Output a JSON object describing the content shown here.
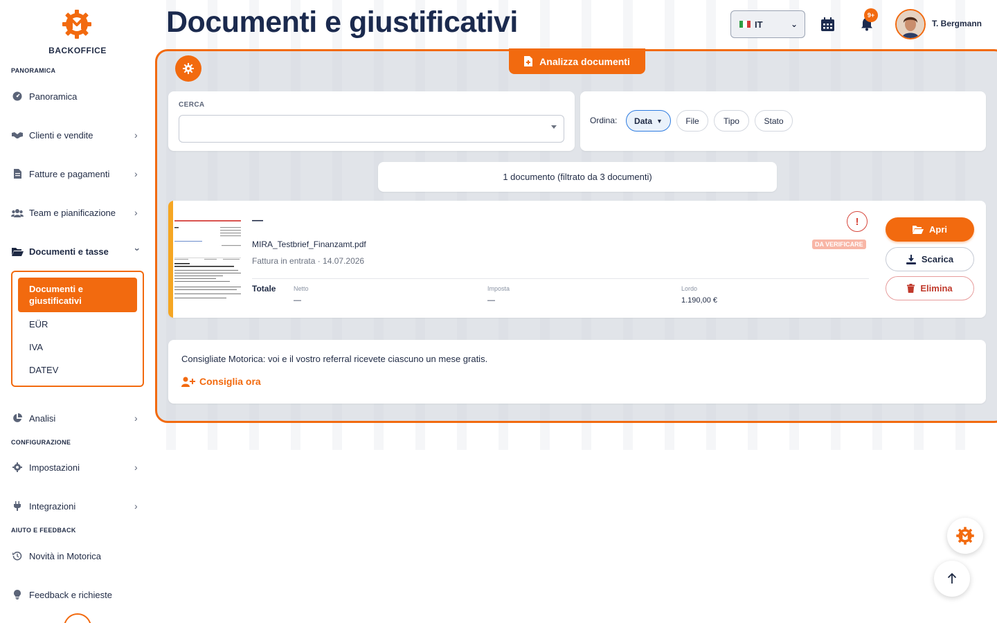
{
  "brand": {
    "name": "BACKOFFICE",
    "accent": "#f26a0f"
  },
  "header": {
    "title": "Documenti e giustificativi",
    "language": "IT",
    "notifications_badge": "9+",
    "user_name": "T. Bergmann"
  },
  "sidebar": {
    "section_overview": "PANORAMICA",
    "items": [
      {
        "label": "Panoramica",
        "icon": "dashboard-icon"
      },
      {
        "label": "Clienti e vendite",
        "icon": "handshake-icon"
      },
      {
        "label": "Fatture e pagamenti",
        "icon": "invoice-icon"
      },
      {
        "label": "Team e pianificazione",
        "icon": "users-icon"
      },
      {
        "label": "Documenti e tasse",
        "icon": "folder-open-icon"
      }
    ],
    "submenu": [
      {
        "label": "Documenti e giustificativi"
      },
      {
        "label": "EÜR"
      },
      {
        "label": "IVA"
      },
      {
        "label": "DATEV"
      }
    ],
    "analytics": {
      "label": "Analisi",
      "icon": "pie-chart-icon"
    },
    "section_config": "CONFIGURAZIONE",
    "settings": {
      "label": "Impostazioni",
      "icon": "gear-icon"
    },
    "integrations": {
      "label": "Integrazioni",
      "icon": "plug-icon"
    },
    "section_help": "AIUTO E FEEDBACK",
    "news": {
      "label": "Novità in Motorica",
      "icon": "history-icon"
    },
    "feedback": {
      "label": "Feedback e richieste",
      "icon": "lightbulb-icon"
    }
  },
  "toolbar": {
    "analyze_label": "Analizza documenti"
  },
  "search": {
    "label": "CERCA",
    "value": ""
  },
  "sort": {
    "label": "Ordina:",
    "options": [
      {
        "label": "Data",
        "active": true,
        "direction": "▼"
      },
      {
        "label": "File"
      },
      {
        "label": "Tipo"
      },
      {
        "label": "Stato"
      }
    ]
  },
  "result_count": "1 documento (filtrato da 3 documenti)",
  "documents": [
    {
      "title": "—",
      "filename": "MIRA_Testbrief_Finanzamt.pdf",
      "meta": "Fattura in entrata · 14.07.2026",
      "status": "DA VERIFICARE",
      "totals_label": "Totale",
      "net_label": "Netto",
      "net_value": "—",
      "tax_label": "Imposta",
      "tax_value": "—",
      "gross_label": "Lordo",
      "gross_value": "1.190,00 €",
      "actions": {
        "open": "Apri",
        "download": "Scarica",
        "delete": "Elimina"
      }
    }
  ],
  "referral": {
    "text": "Consigliate Motorica: voi e il vostro referral ricevete ciascuno un mese gratis.",
    "link": "Consiglia ora"
  }
}
